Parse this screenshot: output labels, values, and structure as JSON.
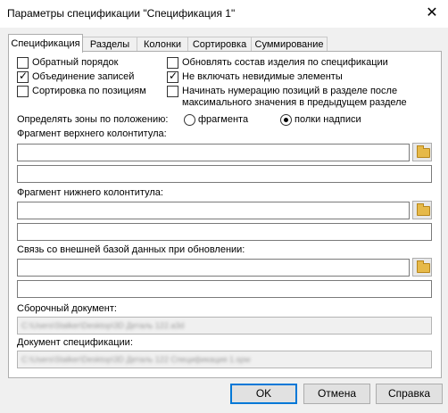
{
  "window": {
    "title": "Параметры спецификации \"Спецификация 1\"",
    "close_label": "✕"
  },
  "tabs": [
    {
      "label": "Спецификация",
      "active": true
    },
    {
      "label": "Разделы",
      "active": false
    },
    {
      "label": "Колонки",
      "active": false
    },
    {
      "label": "Сортировка",
      "active": false
    },
    {
      "label": "Суммирование",
      "active": false
    }
  ],
  "options": {
    "reverse_order": {
      "label": "Обратный порядок",
      "checked": false
    },
    "merge_records": {
      "label": "Объединение записей",
      "checked": true
    },
    "sort_by_positions": {
      "label": "Сортировка по позициям",
      "checked": false
    },
    "update_composition": {
      "label": "Обновлять состав изделия по спецификации",
      "checked": false
    },
    "exclude_invisible": {
      "label": "Не включать невидимые элементы",
      "checked": true
    },
    "start_numbering": {
      "label_line1": "Начинать нумерацию позиций в разделе после",
      "label_line2": "максимального значения в предыдущем разделе",
      "checked": false
    }
  },
  "zones": {
    "label": "Определять зоны по положению:",
    "option_fragment": "фрагмента",
    "option_title_shelf": "полки надписи",
    "selected": "полки надписи"
  },
  "header_fragment": {
    "label": "Фрагмент верхнего колонтитула:",
    "value1": "",
    "value2": ""
  },
  "footer_fragment": {
    "label": "Фрагмент нижнего колонтитула:",
    "value1": "",
    "value2": ""
  },
  "external_db": {
    "label": "Связь со внешней базой данных при обновлении:",
    "value1": "",
    "value2": ""
  },
  "assembly_doc": {
    "label": "Сборочный документ:",
    "value": "C:\\Users\\Stalker\\Desktop\\3D Деталь 122.a3d"
  },
  "spec_doc": {
    "label": "Документ спецификации:",
    "value": "C:\\Users\\Stalker\\Desktop\\3D Деталь 122 Спецификация 1.spw"
  },
  "buttons": {
    "ok": "OK",
    "cancel": "Отмена",
    "help": "Справка"
  },
  "colors": {
    "accent": "#0078d7",
    "panel": "#ffffff",
    "window": "#f0f0f0"
  }
}
